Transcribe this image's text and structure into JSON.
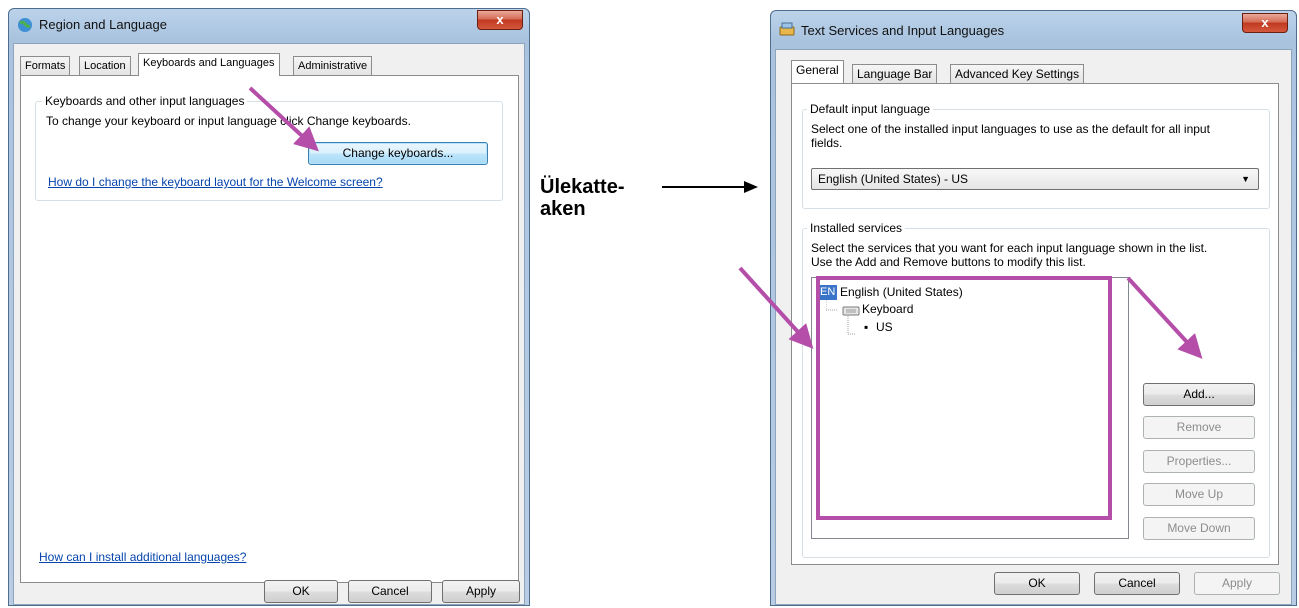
{
  "annotation": {
    "line1": "Ülekatte-",
    "line2": "aken"
  },
  "left_window": {
    "title": "Region and Language",
    "close_label": "x",
    "tabs": [
      "Formats",
      "Location",
      "Keyboards and Languages",
      "Administrative"
    ],
    "group_title": "Keyboards and other input languages",
    "group_text": "To change your keyboard or input language click Change keyboards.",
    "change_button": "Change keyboards...",
    "welcome_link": "How do I change the keyboard layout for the Welcome screen?",
    "install_link": "How can I install additional languages?",
    "ok": "OK",
    "cancel": "Cancel",
    "apply": "Apply"
  },
  "right_window": {
    "title": "Text Services and Input Languages",
    "close_label": "x",
    "tabs": [
      "General",
      "Language Bar",
      "Advanced Key Settings"
    ],
    "default_group_title": "Default input language",
    "default_text_1": "Select one of the installed input languages to use as the default for all input",
    "default_text_2": "fields.",
    "default_selected": "English (United States) - US",
    "installed_group_title": "Installed services",
    "installed_text_1": "Select the services that you want for each input language shown in the list.",
    "installed_text_2": "Use the Add and Remove buttons to modify this list.",
    "tree": {
      "lang_code": "EN",
      "language": "English (United States)",
      "category": "Keyboard",
      "layout": "US"
    },
    "buttons": {
      "add": "Add...",
      "remove": "Remove",
      "properties": "Properties...",
      "move_up": "Move Up",
      "move_down": "Move Down"
    },
    "ok": "OK",
    "cancel": "Cancel",
    "apply": "Apply"
  },
  "colors": {
    "annotation_magenta": "#b44ea9",
    "window_frame": "#a9c3df"
  }
}
